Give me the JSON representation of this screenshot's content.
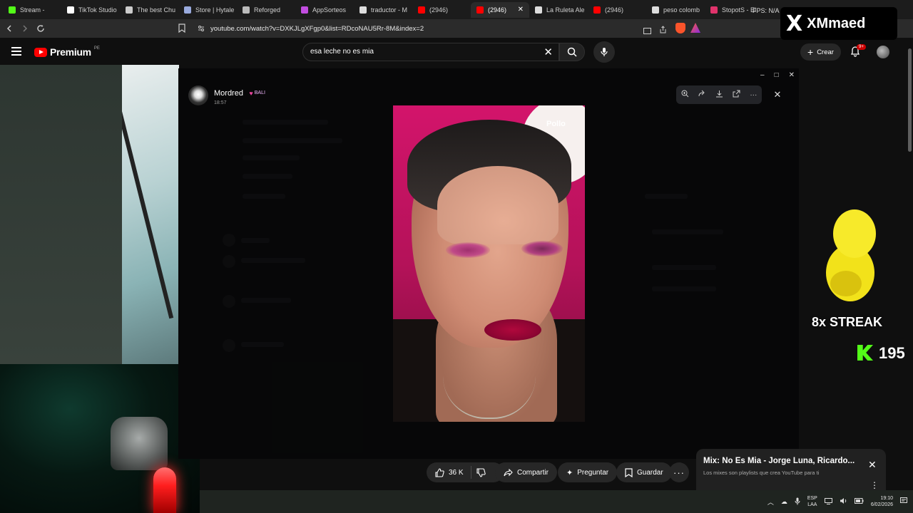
{
  "browser": {
    "tabs": [
      {
        "label": "Stream -",
        "color": "#53fc18",
        "active": false
      },
      {
        "label": "TikTok Studio",
        "color": "#ffffff",
        "active": false
      },
      {
        "label": "The best Chu",
        "color": "#cccccc",
        "active": false
      },
      {
        "label": "Store | Hytale",
        "color": "#9ad",
        "active": false
      },
      {
        "label": "Reforged",
        "color": "#bbbbbb",
        "active": false
      },
      {
        "label": "AppSorteos",
        "color": "#c24de0",
        "active": false
      },
      {
        "label": "traductor - M",
        "color": "#dddddd",
        "active": false
      },
      {
        "label": "(2946)",
        "color": "#ff0000",
        "active": false
      },
      {
        "label": "(2946)",
        "color": "#ff0000",
        "active": true
      },
      {
        "label": "La Ruleta Ale",
        "color": "#dddddd",
        "active": false
      },
      {
        "label": "(2946)",
        "color": "#ff0000",
        "active": false
      },
      {
        "label": "peso colomb",
        "color": "#dddddd",
        "active": false
      },
      {
        "label": "StopotS - El",
        "color": "#e0336b",
        "active": false
      }
    ],
    "fps_label": "FPS: N/A",
    "url": "youtube.com/watch?v=DXKJLgXFgp0&list=RDcoNAU5Rr-8M&index=2"
  },
  "youtube": {
    "logo_text": "Premium",
    "country_code": "PE",
    "search_value": "esa leche no es mia",
    "create_label": "Crear",
    "notif_badge": "9+"
  },
  "overlay": {
    "x_mark": "X",
    "name": "XMmaed",
    "streak_text": "8x STREAK",
    "kick_count": "195"
  },
  "viewer": {
    "sender_name": "Mordred",
    "badge": "BALI",
    "time": "18:57",
    "image_caption": "Pollo"
  },
  "actions": {
    "likes": "36 K",
    "share": "Compartir",
    "ask": "Preguntar",
    "save": "Guardar"
  },
  "mix": {
    "title": "Mix: No Es Mia - Jorge Luna, Ricardo...",
    "subtitle": "Los mixes son playlists que crea YouTube para ti"
  },
  "taskbar": {
    "lang_top": "ESP",
    "lang_bottom": "LAA",
    "time": "19:10",
    "date": "6/02/2026"
  }
}
